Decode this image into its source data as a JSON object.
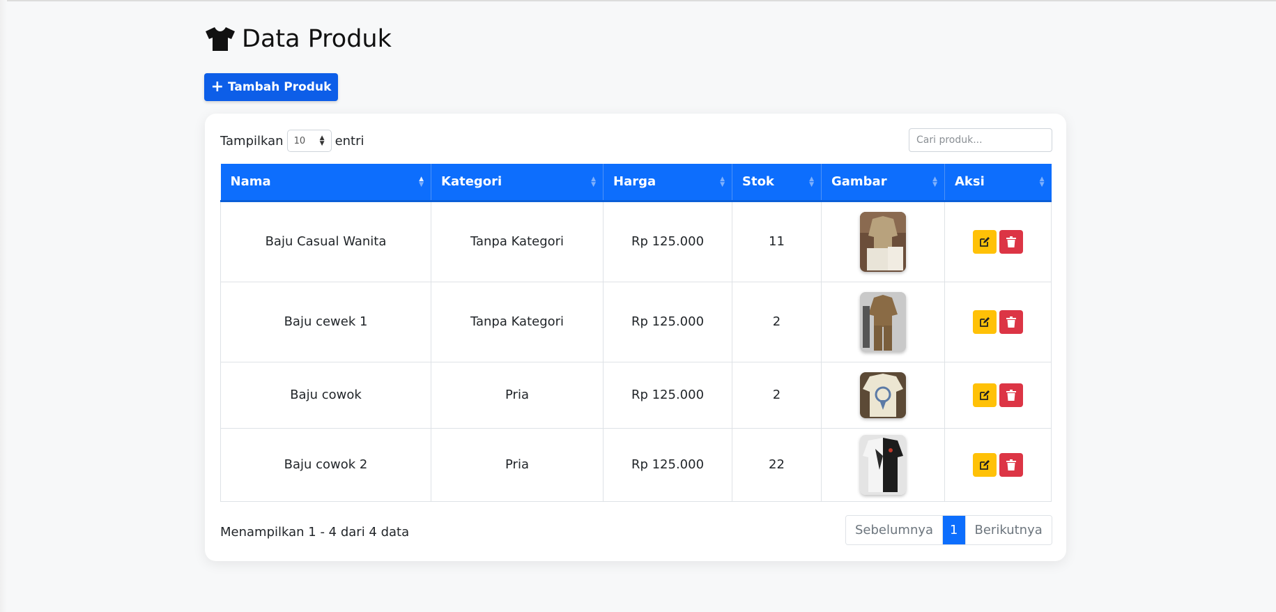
{
  "page": {
    "title": "Data Produk",
    "title_icon": "tshirt-icon"
  },
  "toolbar": {
    "add_label": "Tambah Produk",
    "add_icon": "plus-icon"
  },
  "length_control": {
    "prefix": "Tampilkan",
    "value": "10",
    "suffix": "entri"
  },
  "search": {
    "placeholder": "Cari produk..."
  },
  "table": {
    "columns": [
      "Nama",
      "Kategori",
      "Harga",
      "Stok",
      "Gambar",
      "Aksi"
    ],
    "sorted_column": "Nama",
    "rows": [
      {
        "nama": "Baju Casual Wanita",
        "kategori": "Tanpa Kategori",
        "harga": "Rp 125.000",
        "stok": "11"
      },
      {
        "nama": "Baju cewek 1",
        "kategori": "Tanpa Kategori",
        "harga": "Rp 125.000",
        "stok": "2"
      },
      {
        "nama": "Baju cowok",
        "kategori": "Pria",
        "harga": "Rp 125.000",
        "stok": "2"
      },
      {
        "nama": "Baju cowok 2",
        "kategori": "Pria",
        "harga": "Rp 125.000",
        "stok": "22"
      }
    ]
  },
  "footer": {
    "info": "Menampilkan 1 - 4 dari 4 data",
    "pagination": {
      "prev": "Sebelumnya",
      "current": "1",
      "next": "Berikutnya"
    }
  },
  "colors": {
    "primary": "#0d6efd",
    "edit": "#ffc107",
    "delete": "#dc3545"
  }
}
